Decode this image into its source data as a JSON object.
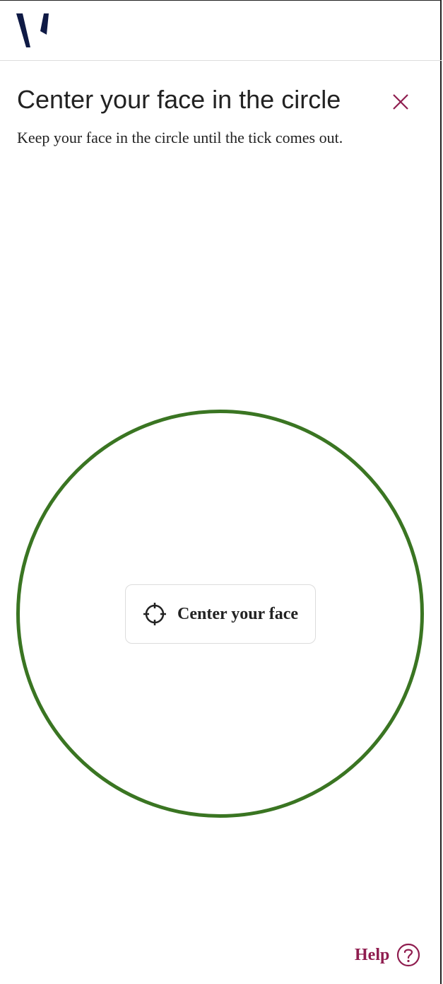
{
  "header": {
    "logo_icon": "brand-v-logo-icon",
    "logo_color": "#0f1a45"
  },
  "dialog": {
    "title": "Center your face in the circle",
    "subtitle": "Keep your face in the circle until the tick comes out.",
    "close_icon": "close-icon",
    "accent_color": "#8f1d4f"
  },
  "camera": {
    "circle_color": "#3a7522",
    "status_icon": "crosshair-icon",
    "status_label": "Center your face"
  },
  "footer": {
    "help_label": "Help",
    "help_icon": "question-circle-icon"
  }
}
